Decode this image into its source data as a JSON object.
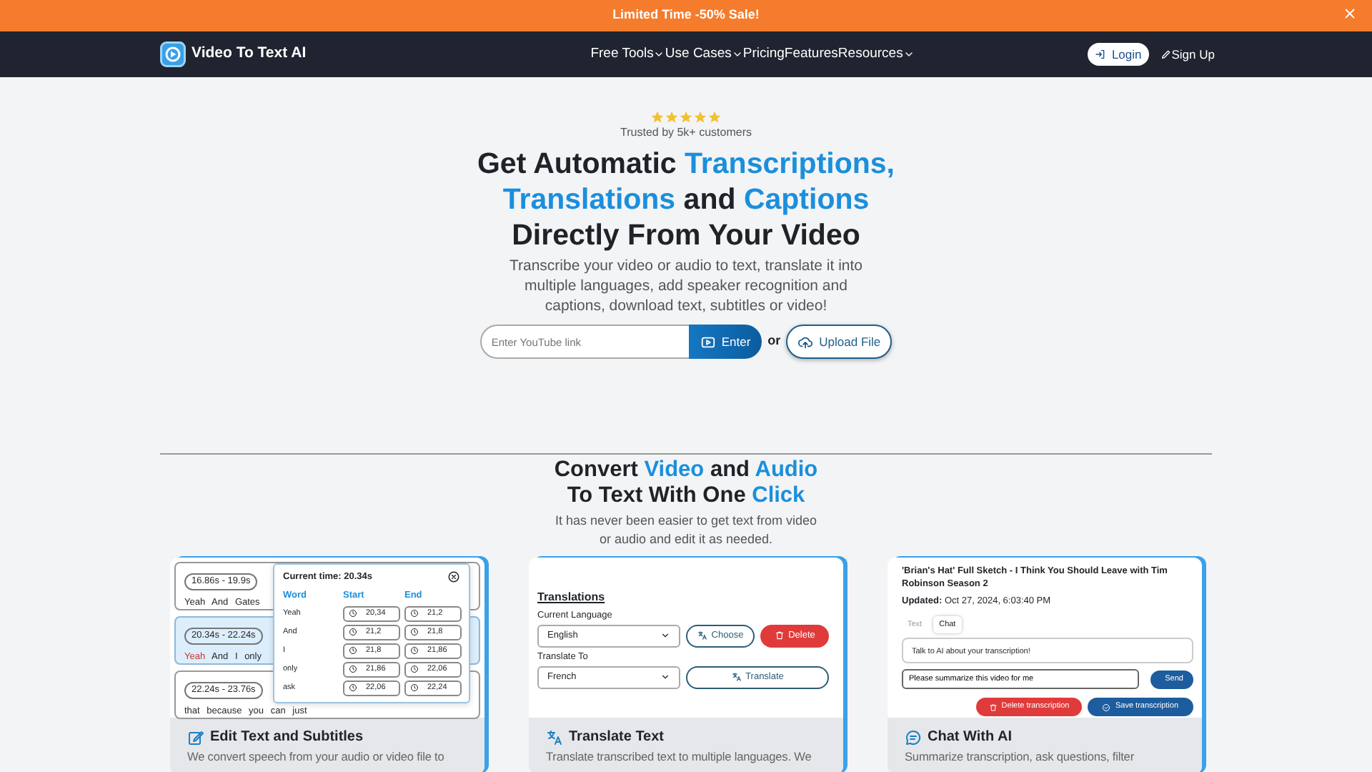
{
  "banner": {
    "text": "Limited Time -50% Sale!"
  },
  "nav": {
    "brand": "Video To Text AI",
    "items": [
      {
        "label": "Free Tools",
        "dropdown": true
      },
      {
        "label": "Use Cases",
        "dropdown": true
      },
      {
        "label": "Pricing",
        "dropdown": false
      },
      {
        "label": "Features",
        "dropdown": false
      },
      {
        "label": "Resources",
        "dropdown": true
      }
    ],
    "login": "Login",
    "signup": "Sign Up"
  },
  "hero": {
    "rating": {
      "stars": 5,
      "text": "Trusted by 5k+ customers"
    },
    "title": [
      [
        {
          "text": "Get Automatic ",
          "accent": false
        },
        {
          "text": "Transcriptions,",
          "accent": true
        }
      ],
      [
        {
          "text": "Translations",
          "accent": true
        },
        {
          "text": " and ",
          "accent": false
        },
        {
          "text": "Captions",
          "accent": true
        }
      ],
      [
        {
          "text": "Directly From Your Video",
          "accent": false
        }
      ]
    ],
    "description": "Transcribe your video or audio to text, translate it into multiple languages, add speaker recognition and captions, download text, subtitles or video!",
    "link_input": {
      "placeholder": "Enter YouTube link"
    },
    "enter": "Enter",
    "or": "or",
    "upload": "Upload File"
  },
  "section": {
    "title": [
      [
        {
          "text": "Convert ",
          "accent": false
        },
        {
          "text": "Video",
          "accent": true
        },
        {
          "text": " and ",
          "accent": false
        },
        {
          "text": "Audio",
          "accent": true
        }
      ],
      [
        {
          "text": "To Text With One ",
          "accent": false
        },
        {
          "text": "Click",
          "accent": true
        }
      ]
    ],
    "description": "It has never been easier to get text from video or audio and edit it as needed."
  },
  "cards": [
    {
      "kind": "subtitles",
      "feature": "Edit Text and Subtitles",
      "description": "We convert speech from your audio or video file to",
      "segments": [
        {
          "time": "16.86s - 19.9s",
          "selected": false,
          "words": [
            {
              "text": "Yeah",
              "current": false
            },
            {
              "text": "And",
              "current": false
            },
            {
              "text": "Gates",
              "current": false
            }
          ]
        },
        {
          "time": "20.34s - 22.24s",
          "selected": true,
          "words": [
            {
              "text": "Yeah",
              "current": true
            },
            {
              "text": "And",
              "current": false
            },
            {
              "text": "I",
              "current": false
            },
            {
              "text": "only",
              "current": false
            }
          ]
        },
        {
          "time": "22.24s - 23.76s",
          "selected": false,
          "words": [
            {
              "text": "that",
              "current": false
            },
            {
              "text": "because",
              "current": false
            },
            {
              "text": "you",
              "current": false
            },
            {
              "text": "can",
              "current": false
            },
            {
              "text": "just",
              "current": false
            }
          ]
        }
      ],
      "popup": {
        "current_time": "Current time: 20.34s",
        "columns": [
          "Word",
          "Start",
          "End"
        ],
        "rows": [
          {
            "word": "Yeah",
            "start": "20,34",
            "end": "21,2"
          },
          {
            "word": "And",
            "start": "21,2",
            "end": "21,8"
          },
          {
            "word": "I",
            "start": "21,8",
            "end": "21,86"
          },
          {
            "word": "only",
            "start": "21,86",
            "end": "22,06"
          },
          {
            "word": "ask",
            "start": "22,06",
            "end": "22,24"
          }
        ]
      }
    },
    {
      "kind": "translate",
      "feature": "Translate Text",
      "description": "Translate transcribed text to multiple languages. We",
      "heading": "Translations",
      "current_label": "Current Language",
      "current_value": "English",
      "choose": "Choose",
      "delete": "Delete",
      "target_label": "Translate To",
      "target_value": "French",
      "translate": "Translate"
    },
    {
      "kind": "chat",
      "feature": "Chat With AI",
      "description": "Summarize transcription, ask questions, filter",
      "title": "'Brian's Hat' Full Sketch - I Think You Should Leave with Tim Robinson Season 2",
      "updated": "**Updated:** Oct 27, 2024, 6:03:40 PM",
      "tabs": [
        {
          "label": "Text",
          "selected": false
        },
        {
          "label": "Chat",
          "selected": true
        }
      ],
      "message": "Talk to AI about your transcription!",
      "input": "Please summarize this video for me",
      "send": "Send",
      "delete": "Delete transcription",
      "save": "Save transcription"
    }
  ]
}
